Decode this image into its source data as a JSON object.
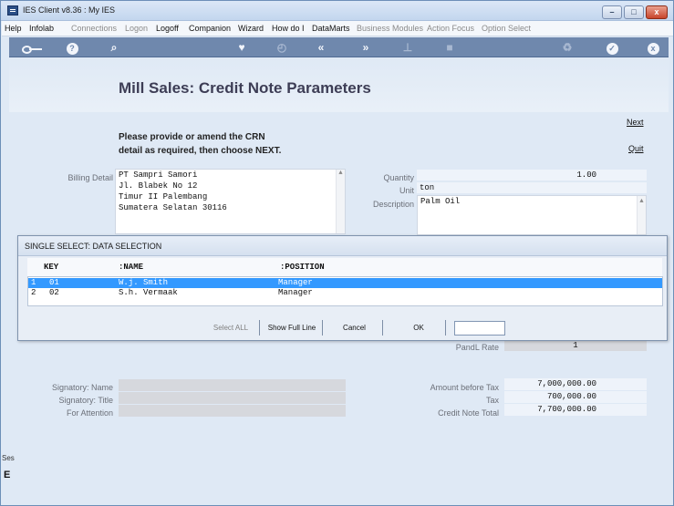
{
  "window": {
    "title": "IES Client v8.36 : My IES",
    "minimize": "–",
    "maximize": "□",
    "close": "x"
  },
  "menu": [
    {
      "label": "Help",
      "enabled": true
    },
    {
      "label": "Infolab",
      "enabled": true
    },
    {
      "label": "Connections",
      "enabled": false
    },
    {
      "label": "Logon",
      "enabled": false
    },
    {
      "label": "Logoff",
      "enabled": true
    },
    {
      "label": "Companion",
      "enabled": true
    },
    {
      "label": "Wizard",
      "enabled": true
    },
    {
      "label": "How do I",
      "enabled": true
    },
    {
      "label": "DataMarts",
      "enabled": true
    },
    {
      "label": "Business Modules",
      "enabled": false
    },
    {
      "label": "Action Focus",
      "enabled": false
    },
    {
      "label": "Option Select",
      "enabled": false
    }
  ],
  "toolbar": {
    "help_glyph": "?",
    "search_glyph": "⌕",
    "favorite_glyph": "♥",
    "history_glyph": "◴",
    "back_glyph": "«",
    "forward_glyph": "»",
    "pin_glyph": "⊥",
    "stop_glyph": "■",
    "recycle_glyph": "♻",
    "ok_glyph": "✓",
    "close_glyph": "x"
  },
  "page": {
    "title": "Mill Sales: Credit Note  Parameters",
    "instruction_line1": "Please provide or amend the CRN",
    "instruction_line2": "detail as required, then choose NEXT.",
    "next_label": "Next",
    "quit_label": "Quit"
  },
  "billing": {
    "label": "Billing Detail",
    "lines": [
      "PT Sampri Samori",
      "Jl. Blabek No 12",
      "Timur II Palembang",
      "Sumatera Selatan 30116"
    ]
  },
  "item": {
    "quantity_label": "Quantity",
    "quantity_value": "1.00",
    "unit_label": "Unit",
    "unit_value": "ton",
    "description_label": "Description",
    "description_value": "Palm Oil"
  },
  "dialog": {
    "title": "SINGLE SELECT: DATA SELECTION",
    "columns": [
      "KEY",
      ":NAME",
      ":POSITION"
    ],
    "rows": [
      {
        "num": "1",
        "key": "01",
        "name": "W.j. Smith",
        "position": "Manager",
        "selected": true
      },
      {
        "num": "2",
        "key": "02",
        "name": "S.h. Vermaak",
        "position": "Manager",
        "selected": false
      }
    ],
    "buttons": {
      "select_all": "Select ALL",
      "show_full_line": "Show Full Line",
      "cancel": "Cancel",
      "ok": "OK"
    },
    "input_value": ""
  },
  "pandl": {
    "label": "PandL Rate",
    "value": "1"
  },
  "signatory": {
    "name_label": "Signatory: Name",
    "title_label": "Signatory: Title",
    "attention_label": "For Attention"
  },
  "totals": {
    "before_tax_label": "Amount before Tax",
    "before_tax_value": "7,000,000.00",
    "tax_label": "Tax",
    "tax_value": "700,000.00",
    "total_label": "Credit Note Total",
    "total_value": "7,700,000.00"
  },
  "statusbar": {
    "ses_text": "Ses",
    "glyph": "E"
  }
}
